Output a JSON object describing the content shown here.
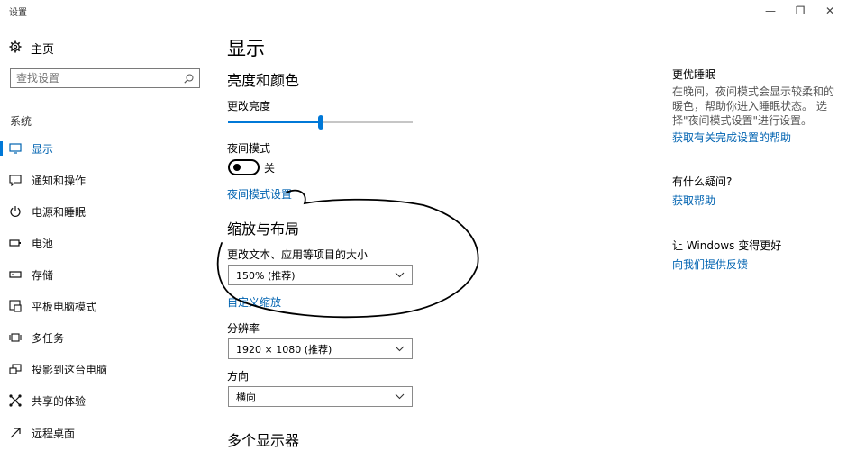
{
  "window": {
    "title": "设置",
    "buttons": {
      "minimize": "—",
      "maximize": "❐",
      "close": "✕"
    }
  },
  "sidebar": {
    "home_label": "主页",
    "search_placeholder": "查找设置",
    "group_label": "系统",
    "items": [
      {
        "label": "显示",
        "icon": "monitor-icon",
        "active": true
      },
      {
        "label": "通知和操作",
        "icon": "notification-icon"
      },
      {
        "label": "电源和睡眠",
        "icon": "power-icon"
      },
      {
        "label": "电池",
        "icon": "battery-icon"
      },
      {
        "label": "存储",
        "icon": "storage-icon"
      },
      {
        "label": "平板电脑模式",
        "icon": "tablet-mode-icon"
      },
      {
        "label": "多任务",
        "icon": "multitask-icon"
      },
      {
        "label": "投影到这台电脑",
        "icon": "project-icon"
      },
      {
        "label": "共享的体验",
        "icon": "shared-experience-icon"
      },
      {
        "label": "远程桌面",
        "icon": "remote-desktop-icon"
      }
    ]
  },
  "main": {
    "title": "显示",
    "brightness_section": "亮度和颜色",
    "brightness_label": "更改亮度",
    "brightness_value": 0.5,
    "night_light_label": "夜间模式",
    "night_light_state": "关",
    "night_light_settings_link": "夜间模式设置",
    "scale_section": "缩放与布局",
    "scale_label": "更改文本、应用等项目的大小",
    "scale_value": "150% (推荐)",
    "custom_scale_link": "自定义缩放",
    "resolution_label": "分辨率",
    "resolution_value": "1920 × 1080 (推荐)",
    "orientation_label": "方向",
    "orientation_value": "横向",
    "multiple_displays_section": "多个显示器"
  },
  "right": {
    "sleep_heading": "更优睡眠",
    "sleep_text": "在晚间，夜间模式会显示较柔和的暖色，帮助你进入睡眠状态。 选择\"夜间模式设置\"进行设置。",
    "sleep_link": "获取有关完成设置的帮助",
    "question_heading": "有什么疑问?",
    "help_link": "获取帮助",
    "improve_heading": "让 Windows 变得更好",
    "feedback_link": "向我们提供反馈"
  },
  "colors": {
    "accent": "#0078d7",
    "link": "#0063b1",
    "annotation": "#000000"
  }
}
